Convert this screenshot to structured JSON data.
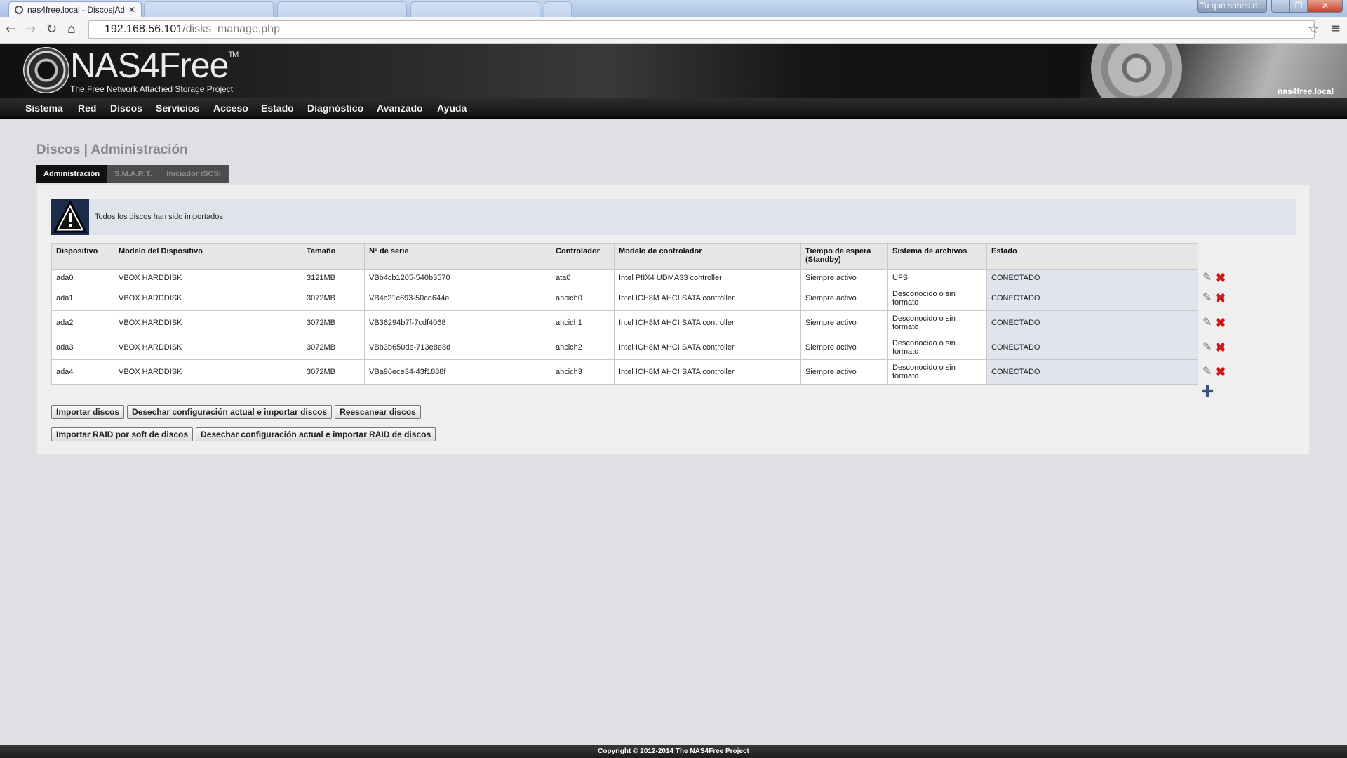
{
  "browser": {
    "active_tab": "nas4free.local - Discos|Ad",
    "inactive_tabs": [
      "",
      "",
      "",
      ""
    ],
    "profile_label": "Tu que sabes d...",
    "url_host": "192.168.56.101",
    "url_path": "/disks_manage.php"
  },
  "header": {
    "logo_main": "NAS4Free",
    "logo_tm": "TM",
    "tagline": "The Free Network Attached Storage Project",
    "hostname": "nas4free.local"
  },
  "menu": [
    "Sistema",
    "Red",
    "Discos",
    "Servicios",
    "Acceso",
    "Estado",
    "Diagnóstico",
    "Avanzado",
    "Ayuda"
  ],
  "page": {
    "title": "Discos | Administración",
    "tabs": [
      "Administración",
      "S.M.A.R.T.",
      "Iniciador iSCSI"
    ],
    "notice": "Todos los discos han sido importados."
  },
  "table": {
    "headers": [
      "Dispositivo",
      "Modelo del Dispositivo",
      "Tamaño",
      "Nº de serie",
      "Controlador",
      "Modelo de controlador",
      "Tiempo de espera (Standby)",
      "Sistema de archivos",
      "Estado"
    ],
    "rows": [
      [
        "ada0",
        "VBOX HARDDISK",
        "3121MB",
        "VBb4cb1205-540b3570",
        "ata0",
        "Intel PIIX4 UDMA33 controller",
        "Siempre activo",
        "UFS",
        "CONECTADO"
      ],
      [
        "ada1",
        "VBOX HARDDISK",
        "3072MB",
        "VB4c21c693-50cd644e",
        "ahcich0",
        "Intel ICH8M AHCI SATA controller",
        "Siempre activo",
        "Desconocido o sin formato",
        "CONECTADO"
      ],
      [
        "ada2",
        "VBOX HARDDISK",
        "3072MB",
        "VB36294b7f-7cdf4068",
        "ahcich1",
        "Intel ICH8M AHCI SATA controller",
        "Siempre activo",
        "Desconocido o sin formato",
        "CONECTADO"
      ],
      [
        "ada3",
        "VBOX HARDDISK",
        "3072MB",
        "VBb3b650de-713e8e8d",
        "ahcich2",
        "Intel ICH8M AHCI SATA controller",
        "Siempre activo",
        "Desconocido o sin formato",
        "CONECTADO"
      ],
      [
        "ada4",
        "VBOX HARDDISK",
        "3072MB",
        "VBa96ece34-43f1888f",
        "ahcich3",
        "Intel ICH8M AHCI SATA controller",
        "Siempre activo",
        "Desconocido o sin formato",
        "CONECTADO"
      ]
    ]
  },
  "buttons": {
    "import_disks": "Importar discos",
    "discard_import": "Desechar configuración actual e importar discos",
    "rescan": "Reescanear discos",
    "import_raid": "Importar RAID por soft de discos",
    "discard_import_raid": "Desechar configuración actual e importar RAID de discos"
  },
  "footer": "Copyright © 2012-2014 The NAS4Free Project",
  "colors": {
    "menu_bg": "#1a1a1a",
    "status_cell": "#e1e4ec",
    "delete": "#d01818"
  }
}
